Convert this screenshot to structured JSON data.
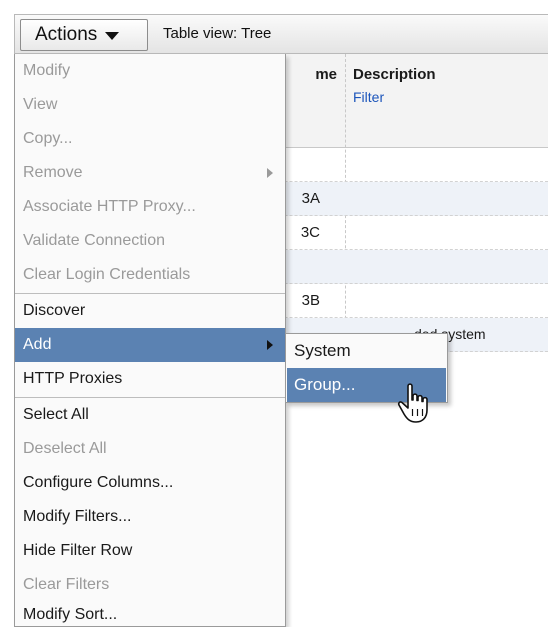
{
  "toolbar": {
    "actions_label": "Actions",
    "table_view_label": "Table view: Tree"
  },
  "table": {
    "header": {
      "name_fragment": "me",
      "description": "Description",
      "filter_link": "Filter"
    },
    "rows": [
      {
        "name_fragment": "",
        "desc_fragment": ""
      },
      {
        "name_fragment": "3A",
        "desc_fragment": ""
      },
      {
        "name_fragment": "3C",
        "desc_fragment": ""
      },
      {
        "name_fragment": "",
        "desc_fragment": ""
      },
      {
        "name_fragment": "3B",
        "desc_fragment": ""
      },
      {
        "name_fragment": "",
        "desc_fragment": "ded system"
      }
    ]
  },
  "menu": {
    "items": [
      {
        "label": "Modify",
        "enabled": false
      },
      {
        "label": "View",
        "enabled": false
      },
      {
        "label": "Copy...",
        "enabled": false
      },
      {
        "label": "Remove",
        "enabled": false
      },
      {
        "label": "Associate HTTP Proxy...",
        "enabled": false
      },
      {
        "label": "Validate Connection",
        "enabled": false
      },
      {
        "label": "Clear Login Credentials",
        "enabled": false
      },
      {
        "label": "Discover",
        "enabled": true
      },
      {
        "label": "Add",
        "enabled": true,
        "hover": true
      },
      {
        "label": "HTTP Proxies",
        "enabled": true
      },
      {
        "label": "Select All",
        "enabled": true
      },
      {
        "label": "Deselect All",
        "enabled": false
      },
      {
        "label": "Configure Columns...",
        "enabled": true
      },
      {
        "label": "Modify Filters...",
        "enabled": true
      },
      {
        "label": "Hide Filter Row",
        "enabled": true
      },
      {
        "label": "Clear Filters",
        "enabled": false
      },
      {
        "label": "Modify Sort...",
        "enabled": true
      }
    ]
  },
  "submenu": {
    "items": [
      {
        "label": "System"
      },
      {
        "label": "Group...",
        "hover": true
      }
    ]
  },
  "colors": {
    "menu_hover": "#5b82b2",
    "disabled_text": "#9a9a9a",
    "filter_link": "#1c55bb"
  },
  "icons": {
    "actions_caret": "caret-down-icon",
    "submenu_arrow": "chevron-right-icon",
    "cursor": "hand-pointer-icon"
  }
}
